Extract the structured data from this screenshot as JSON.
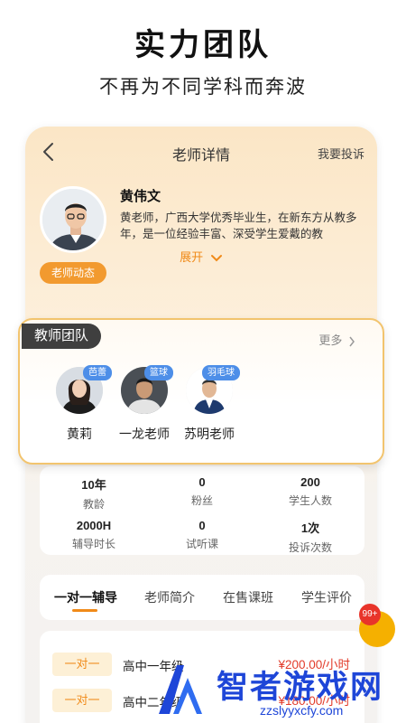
{
  "hero": {
    "title": "实力团队",
    "subtitle": "不再为不同学科而奔波"
  },
  "nav": {
    "title": "老师详情",
    "report_label": "我要投诉"
  },
  "teacher": {
    "name": "黄伟文",
    "description": "黄老师，广西大学优秀毕业生，在新东方从教多年，是一位经验丰富、深受学生爱戴的教",
    "dynamics_label": "老师动态",
    "expand_label": "展开"
  },
  "team": {
    "tag": "教师团队",
    "more_label": "更多",
    "members": [
      {
        "name": "黄莉",
        "badge": "芭蕾"
      },
      {
        "name": "一龙老师",
        "badge": "篮球"
      },
      {
        "name": "苏明老师",
        "badge": "羽毛球"
      }
    ]
  },
  "stats": [
    {
      "value": "10年",
      "label": "教龄"
    },
    {
      "value": "0",
      "label": "粉丝"
    },
    {
      "value": "200",
      "label": "学生人数"
    },
    {
      "value": "2000H",
      "label": "辅导时长"
    },
    {
      "value": "0",
      "label": "试听课"
    },
    {
      "value": "1次",
      "label": "投诉次数"
    }
  ],
  "tabs": [
    {
      "label": "一对一辅导"
    },
    {
      "label": "老师简介"
    },
    {
      "label": "在售课班"
    },
    {
      "label": "学生评价"
    }
  ],
  "notification_badge": "99+",
  "pricing": [
    {
      "type": "一对一",
      "grade": "高中一年级",
      "price": "¥200.00/小时"
    },
    {
      "type": "一对一",
      "grade": "高中二年级",
      "price": "¥180.00/小时"
    }
  ],
  "watermark": {
    "text": "智者游戏网",
    "url": "zzslyyxcfy.com"
  },
  "colors": {
    "accent": "#f08a18",
    "badge_blue": "#4d8ee8",
    "price_red": "#e23b2a",
    "watermark_blue": "#1e46d8"
  }
}
